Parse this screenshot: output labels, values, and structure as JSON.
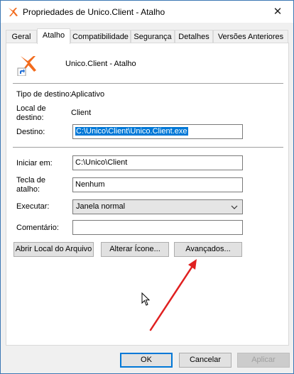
{
  "window": {
    "title": "Propriedades de Unico.Client - Atalho",
    "close_label": "✕"
  },
  "tabs": [
    {
      "label": "Geral"
    },
    {
      "label": "Atalho"
    },
    {
      "label": "Compatibilidade"
    },
    {
      "label": "Segurança"
    },
    {
      "label": "Detalhes"
    },
    {
      "label": "Versões Anteriores"
    }
  ],
  "shortcut": {
    "name": "Unico.Client - Atalho",
    "target_type_label": "Tipo de destino:",
    "target_type_value": "Aplicativo",
    "target_location_label": "Local de\ndestino:",
    "target_location_value": "Client",
    "target_label": "Destino:",
    "target_value": "C:\\Unico\\Client\\Unico.Client.exe",
    "start_in_label": "Iniciar em:",
    "start_in_value": "C:\\Unico\\Client",
    "hotkey_label": "Tecla de\natalho:",
    "hotkey_value": "Nenhum",
    "run_label": "Executar:",
    "run_value": "Janela normal",
    "comment_label": "Comentário:",
    "comment_value": ""
  },
  "buttons": {
    "open_location": "Abrir Local do Arquivo",
    "change_icon": "Alterar Ícone...",
    "advanced": "Avançados...",
    "ok": "OK",
    "cancel": "Cancelar",
    "apply": "Aplicar"
  },
  "colors": {
    "accent": "#0078d7",
    "annotation_arrow": "#e02020",
    "app_icon": "#f26b1d"
  }
}
